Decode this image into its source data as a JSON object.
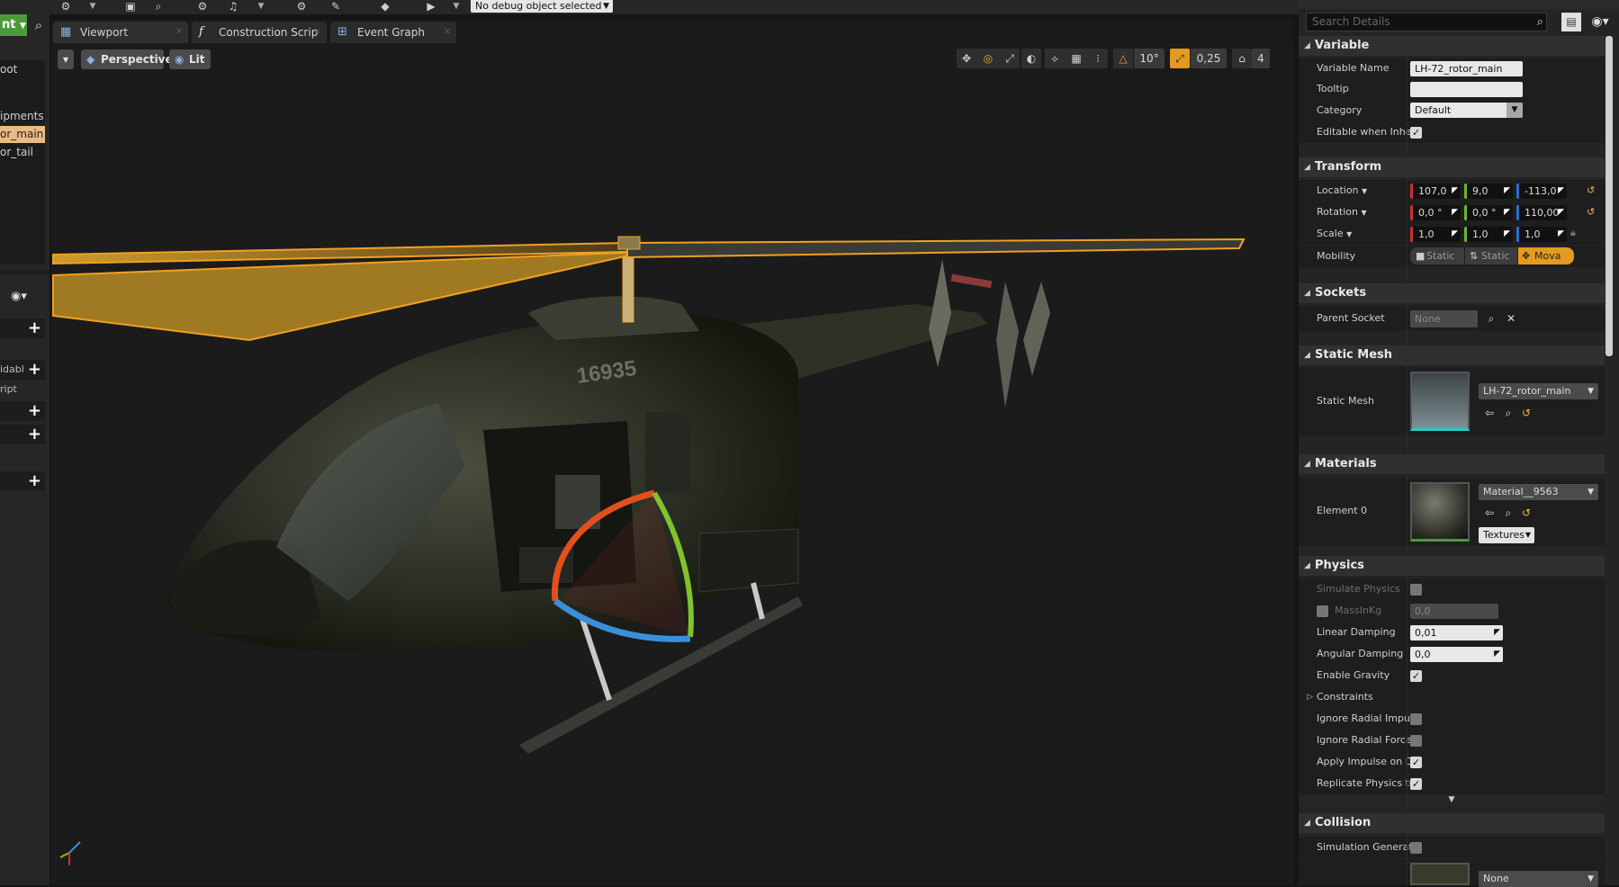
{
  "toolbar": {
    "debug_select": "No debug object selected"
  },
  "left_panel": {
    "mode_label": "nt",
    "tree_items": [
      "oot",
      "ipments",
      "or_main",
      "or_tail"
    ],
    "rows": [
      "",
      "idabl",
      "ript",
      "",
      ""
    ]
  },
  "tabs": [
    {
      "label": "Viewport"
    },
    {
      "label": "Construction Scrip"
    },
    {
      "label": "Event Graph"
    }
  ],
  "viewport": {
    "perspective_label": "Perspective",
    "lit_label": "Lit",
    "rotation_snap": "10°",
    "scale_snap": "0,25",
    "camera_speed": "4",
    "fuselage_text": "16935"
  },
  "details": {
    "search_placeholder": "Search Details",
    "sections": {
      "variable": "Variable",
      "transform": "Transform",
      "sockets": "Sockets",
      "static_mesh": "Static Mesh",
      "materials": "Materials",
      "physics": "Physics",
      "collision": "Collision"
    },
    "variable": {
      "name_label": "Variable Name",
      "name_value": "LH-72_rotor_main",
      "tooltip_label": "Tooltip",
      "tooltip_value": "",
      "category_label": "Category",
      "category_value": "Default",
      "editable_label": "Editable when Inheri"
    },
    "transform": {
      "location_label": "Location",
      "location": [
        "107,0",
        "9,0",
        "-113,0"
      ],
      "rotation_label": "Rotation",
      "rotation": [
        "0,0 °",
        "0,0 °",
        "110,00"
      ],
      "scale_label": "Scale",
      "scale": [
        "1,0",
        "1,0",
        "1,0"
      ],
      "mobility_label": "Mobility",
      "mobility": [
        "Static",
        "Static",
        "Mova"
      ]
    },
    "sockets": {
      "parent_label": "Parent Socket",
      "parent_value": "None"
    },
    "static_mesh": {
      "label": "Static Mesh",
      "value": "LH-72_rotor_main"
    },
    "materials": {
      "element_label": "Element 0",
      "value": "Material__9563",
      "textures_label": "Textures"
    },
    "physics": {
      "simulate_label": "Simulate Physics",
      "mass_label": "MassInKg",
      "mass_value": "0,0",
      "linear_label": "Linear Damping",
      "linear_value": "0,01",
      "angular_label": "Angular Damping",
      "angular_value": "0,0",
      "gravity_label": "Enable Gravity",
      "constraints_label": "Constraints",
      "ignore_radial_impulse_label": "Ignore Radial Impuls",
      "ignore_radial_force_label": "Ignore Radial Force",
      "apply_impulse_label": "Apply Impulse on Da",
      "replicate_label": "Replicate Physics tc"
    },
    "collision": {
      "sim_label": "Simulation Generate",
      "value": "None"
    }
  },
  "colors": {
    "accent_orange": "#e39a1f",
    "selection_outline": "#f0a020",
    "axis_x": "#c83232",
    "axis_y": "#6cb52f",
    "axis_z": "#2d6cd0"
  }
}
